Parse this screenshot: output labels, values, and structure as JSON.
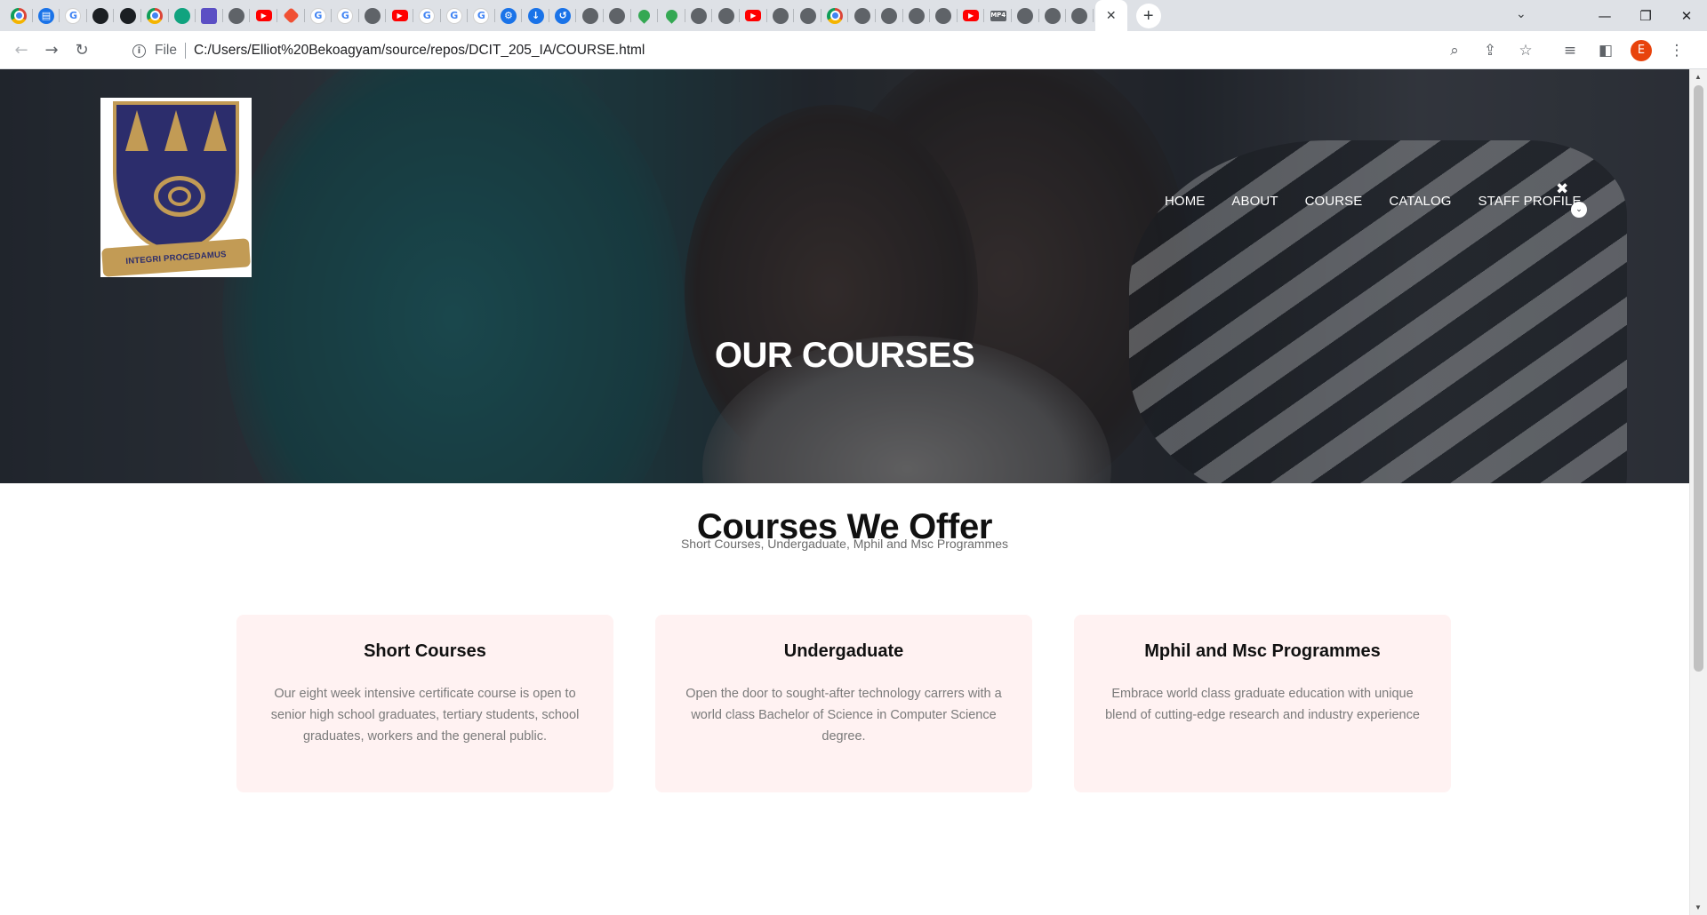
{
  "browser": {
    "tab_favicons": [
      "chrome",
      "print",
      "google",
      "github",
      "github",
      "chrome",
      "chatgpt",
      "azure",
      "globe",
      "youtube",
      "git",
      "google",
      "google",
      "globe",
      "youtube",
      "google",
      "google",
      "google",
      "settings",
      "download",
      "history",
      "globe",
      "globe",
      "maps",
      "maps",
      "globe",
      "globe",
      "youtube",
      "globe",
      "globe",
      "chrome",
      "globe",
      "globe",
      "globe",
      "globe",
      "youtube",
      "mp4",
      "globe",
      "globe",
      "globe"
    ],
    "active_tab_close": "✕",
    "new_tab": "+",
    "tab_search": "⌄",
    "window": {
      "minimize": "—",
      "restore": "❐",
      "close": "✕"
    },
    "address": {
      "scheme_label": "File",
      "url": "C:/Users/Elliot%20Bekoagyam/source/repos/DCIT_205_IA/COURSE.html"
    },
    "profile_initial": "E"
  },
  "site": {
    "logo": {
      "motto": "INTEGRI PROCEDAMUS",
      "colors": {
        "navy": "#2c2d6c",
        "gold": "#c29b55"
      }
    },
    "nav": {
      "items": [
        "HOME",
        "ABOUT",
        "COURSE",
        "CATALOG",
        "STAFF PROFILE"
      ],
      "close_glyph": "✖",
      "chevron_glyph": "⌄"
    },
    "hero": {
      "title": "OUR COURSES"
    },
    "offer": {
      "title": "Courses We Offer",
      "subtitle": "Short Courses, Undergaduate, Mphil and Msc Programmes"
    },
    "cards": [
      {
        "title": "Short Courses",
        "text": "Our eight week intensive certificate course is open to senior high school graduates, tertiary students, school graduates, workers and the general public."
      },
      {
        "title": "Undergaduate",
        "text": "Open the door to sought-after technology carrers with a world class Bachelor of Science in Computer Science degree."
      },
      {
        "title": "Mphil and Msc Programmes",
        "text": "Embrace world class graduate education with unique blend of cutting-edge research and industry experience"
      }
    ],
    "colors": {
      "card_bg": "#fff2f2",
      "heading": "#111111",
      "muted": "#7a7a7a"
    }
  }
}
